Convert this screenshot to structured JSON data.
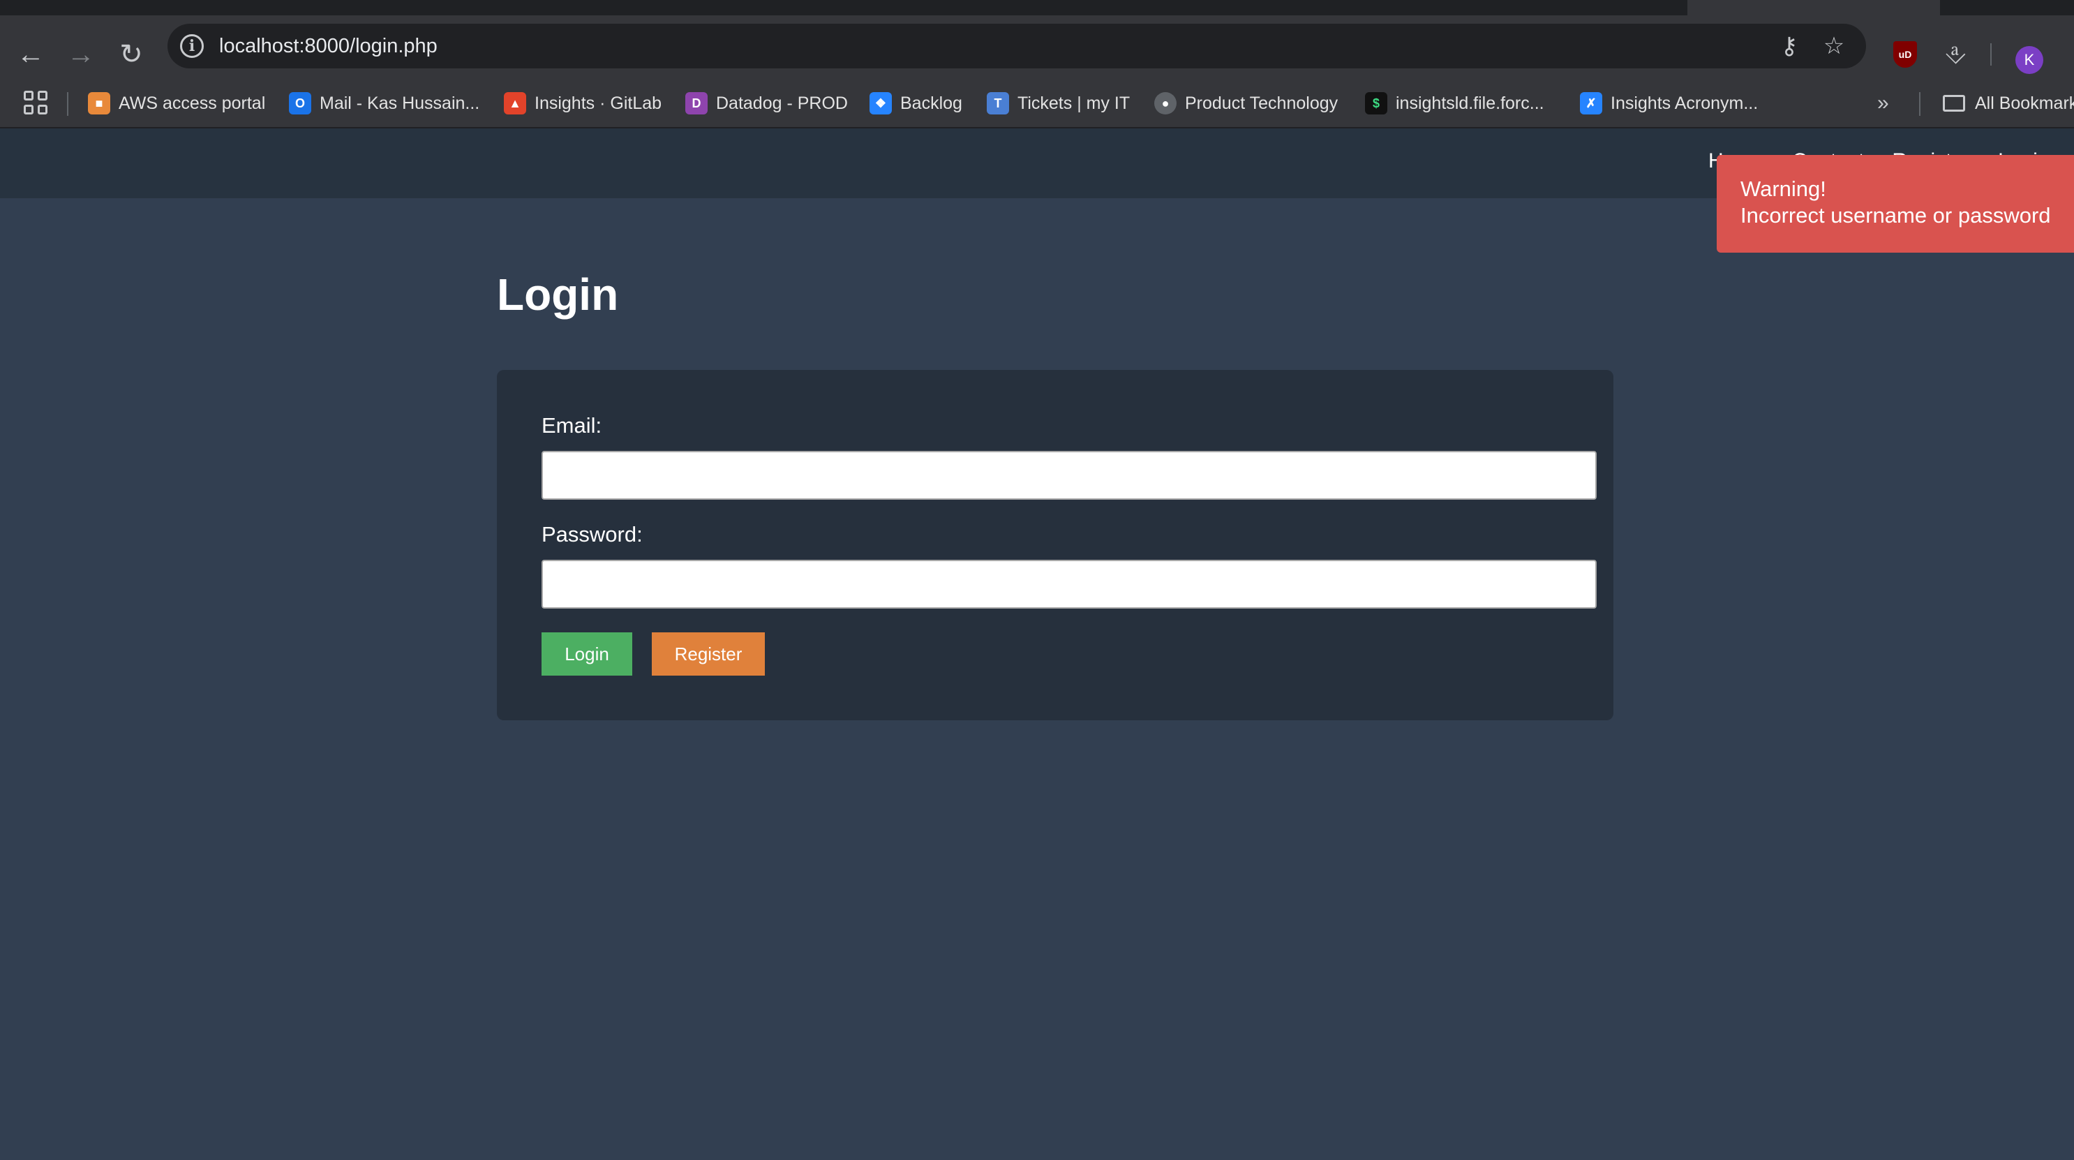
{
  "browser": {
    "url": "localhost:8000/login.php",
    "profile_initial": "K",
    "ublock_label": "uD",
    "bookmarks": [
      {
        "label": "AWS access portal",
        "icon": "aws-icon",
        "color": "#e8893a"
      },
      {
        "label": "Mail - Kas Hussain...",
        "icon": "outlook-icon",
        "color": "#1a73e8"
      },
      {
        "label": "Insights · GitLab",
        "icon": "gitlab-icon",
        "color": "#e2432a"
      },
      {
        "label": "Datadog - PROD",
        "icon": "datadog-icon",
        "color": "#8e44ad"
      },
      {
        "label": "Backlog",
        "icon": "jira-icon",
        "color": "#2684ff"
      },
      {
        "label": "Tickets | my IT",
        "icon": "tickets-icon",
        "color": "#4a7fd4"
      },
      {
        "label": "Product Technology",
        "icon": "globe-icon",
        "color": "#9aa0a6"
      },
      {
        "label": "insightsld.file.forc...",
        "icon": "salesforce-icon",
        "color": "#0f9d58"
      },
      {
        "label": "Insights Acronym...",
        "icon": "confluence-icon",
        "color": "#2684ff"
      }
    ],
    "all_bookmarks": "All Bookmarks"
  },
  "site": {
    "nav": [
      "Home",
      "Contact",
      "Register",
      "Login"
    ]
  },
  "login": {
    "title": "Login",
    "email_label": "Email:",
    "email_value": "",
    "password_label": "Password:",
    "password_value": "",
    "login_button": "Login",
    "register_button": "Register",
    "login_color": "#4caf62",
    "register_color": "#e0813b"
  },
  "toast": {
    "title": "Warning!",
    "message": "Incorrect username or password",
    "color": "#d9534f"
  }
}
